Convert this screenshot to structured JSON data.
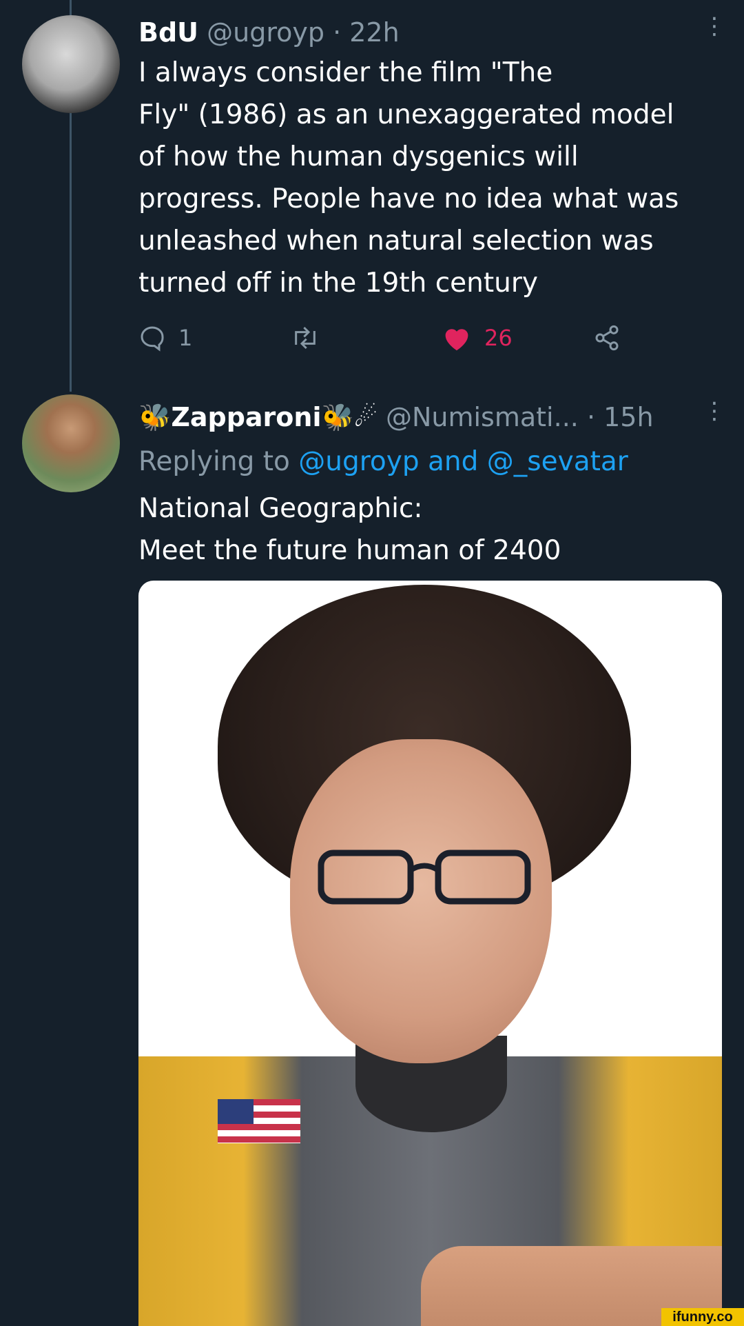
{
  "tweets": [
    {
      "name": "BdU",
      "handle": "@ugroyp",
      "time": "· 22h",
      "text": "I always consider the film \"The\nFly\" (1986) as an unexaggerated model\nof how the human dysgenics will\nprogress. People have no idea what was\nunleashed when natural selection was\nturned off in the 19th century",
      "replies": "1",
      "likes": "26"
    },
    {
      "name": "🐝Zapparoni🐝☄",
      "handle": "@Numismati...",
      "time": "· 15h",
      "replying_prefix": "Replying to ",
      "replying_mentions": "@ugroyp and @_sevatar",
      "text": "National Geographic:\nMeet the future human of 2400"
    }
  ],
  "icons": {
    "more": "more-vertical-icon",
    "reply": "reply-icon",
    "retweet": "retweet-icon",
    "like": "heart-icon",
    "share": "share-icon"
  },
  "colors": {
    "background": "#15202b",
    "secondary_text": "#8899a6",
    "like": "#e0245e",
    "link": "#1da1f2"
  },
  "watermark": "ifunny.co"
}
